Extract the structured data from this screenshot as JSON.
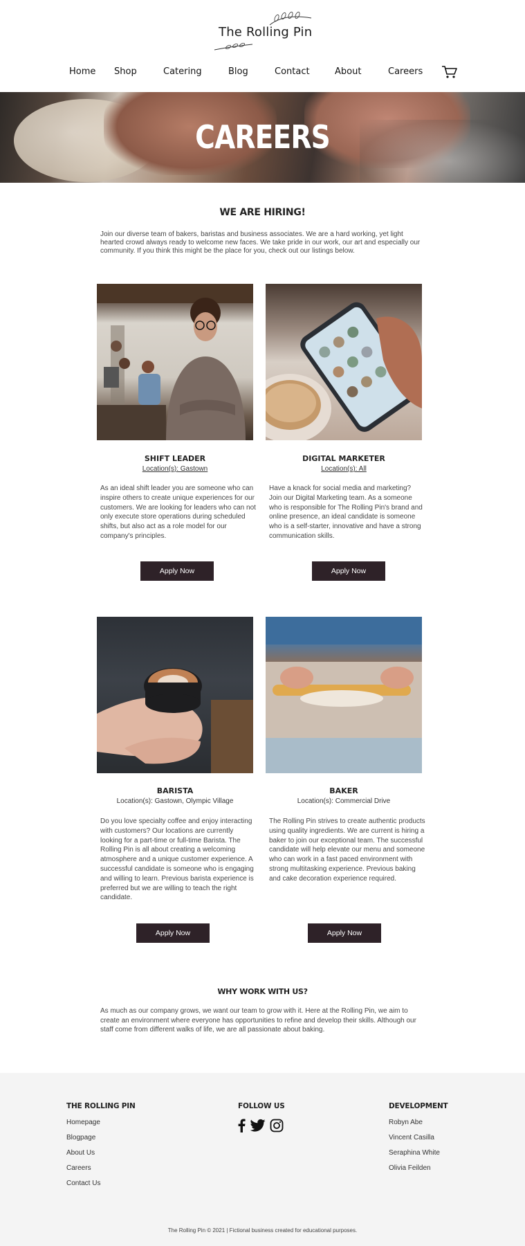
{
  "brand": {
    "name": "The Rolling Pin"
  },
  "nav": {
    "items": [
      "Home",
      "Shop",
      "Catering",
      "Blog",
      "Contact",
      "About",
      "Careers"
    ]
  },
  "hero": {
    "title": "CAREERS"
  },
  "hiring": {
    "title": "WE ARE HIRING!",
    "intro": "Join our diverse team of bakers, baristas and business associates. We are a hard working, yet light hearted crowd always ready to welcome new faces. We take pride in our work, our art and especially our community. If you think this might be the place for you, check out our listings below."
  },
  "jobs": [
    {
      "title": "SHIFT LEADER",
      "location": "Location(s): Gastown",
      "description": "As an ideal shift leader you are someone who can inspire others to create unique experiences for our customers. We are looking for leaders who can not only execute store operations during scheduled shifts, but also act as a role model for our company's principles.",
      "apply": "Apply Now"
    },
    {
      "title": "DIGITAL MARKETER",
      "location": "Location(s): All",
      "description": "Have a knack for social media and marketing? Join our Digital Marketing team. As a someone who is responsible for The Rolling Pin's brand and online presence, an ideal candidate is someone who is a self-starter, innovative and have a strong communication skills.",
      "apply": "Apply Now"
    },
    {
      "title": "BARISTA",
      "location": "Location(s): Gastown, Olympic Village",
      "description": "Do you love specialty coffee and enjoy interacting with customers? Our locations are currently looking for a part-time or full-time Barista. The Rolling Pin is all about creating a welcoming atmosphere and a unique customer experience. A successful candidate is someone who is engaging and willing to learn. Previous barista experience is preferred but we are willing to teach the right candidate.",
      "apply": "Apply Now"
    },
    {
      "title": "BAKER",
      "location": "Location(s): Commercial Drive",
      "description": "The Rolling Pin strives to create authentic products using quality ingredients. We are current is hiring a baker to join our exceptional team. The successful candidate will help elevate our menu and someone who can work in a fast paced environment with strong multitasking experience. Previous baking and cake decoration experience required.",
      "apply": "Apply Now"
    }
  ],
  "why": {
    "title": "WHY WORK WITH US?",
    "text": "As much as our company grows, we want our team to grow with it. Here at the Rolling Pin, we aim to create an environment where everyone has opportunities to refine and develop their skills. Although our staff come from different walks of life, we are all passionate about baking."
  },
  "footer": {
    "col1": {
      "title": "THE ROLLING PIN",
      "links": [
        "Homepage",
        "Blogpage",
        "About Us",
        "Careers",
        "Contact Us"
      ]
    },
    "col2": {
      "title": "FOLLOW US",
      "icons": [
        "facebook-icon",
        "twitter-icon",
        "instagram-icon"
      ]
    },
    "col3": {
      "title": "DEVELOPMENT",
      "names": [
        "Robyn Abe",
        "Vincent Casilla",
        "Seraphina White",
        "Olivia Feilden"
      ]
    },
    "copyright": "The Rolling Pin © 2021 | Fictional business created for educational purposes."
  },
  "colors": {
    "button": "#2e2228",
    "footer_bg": "#f4f4f4"
  }
}
